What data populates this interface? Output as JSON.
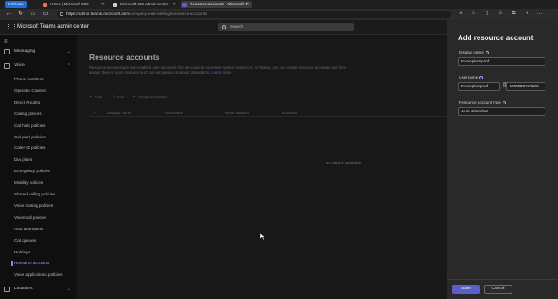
{
  "browser": {
    "inprivate_label": "InPrivate",
    "tabs": [
      {
        "label": "Home | Microsoft 365",
        "favicon_color": "#e8744b"
      },
      {
        "label": "Microsoft 365 admin center",
        "favicon_color": "#cfcfcf"
      },
      {
        "label": "Resource accounts - Microsoft T",
        "favicon_color": "#5b5fc7"
      }
    ],
    "new_tab": "+",
    "url_host": "https://admin.teams.microsoft.com",
    "url_path": "/company-wide-settings/resource-accounts"
  },
  "header": {
    "menu_icon": "waffle-icon",
    "app_title": "Microsoft Teams admin center",
    "search_placeholder": "Search"
  },
  "sidebar": {
    "top_items": [
      {
        "label": "Messaging",
        "icon": "chat-icon",
        "chevron": "⌄"
      },
      {
        "label": "Voice",
        "icon": "phone-icon",
        "chevron": "⌃"
      }
    ],
    "voice_items": [
      "Phone numbers",
      "Operator Connect",
      "Direct Routing",
      "Calling policies",
      "Call hold policies",
      "Call park policies",
      "Caller ID policies",
      "Dial plans",
      "Emergency policies",
      "Mobility policies",
      "Shared calling policies",
      "Voice routing policies",
      "Voicemail policies",
      "Auto attendants",
      "Call queues",
      "Holidays",
      "Resource accounts",
      "Voice applications policies"
    ],
    "active_item": "Resource accounts",
    "bottom_item": {
      "label": "Locations",
      "icon": "location-icon",
      "chevron": "⌄"
    }
  },
  "main": {
    "title": "Resource accounts",
    "description": "Resource accounts are non-enabled user accounts that are used to represent system resources. In Teams, you can create resource accounts and then assign them to voice features such as call queues and auto attendants.",
    "learn_more": "Learn more",
    "commands": [
      {
        "label": "Add",
        "icon": "+"
      },
      {
        "label": "Edit",
        "icon": "✎"
      },
      {
        "label": "Assign/unassign",
        "icon": "⚭"
      }
    ],
    "columns": [
      "Display name",
      "Username",
      "Phone number",
      "Licensed"
    ],
    "empty_message": "No data is available"
  },
  "panel": {
    "title": "Add resource account",
    "display_name_label": "Display name",
    "display_name_value": "Example Spoof",
    "username_label": "Username",
    "username_value": "ExampleSpoof",
    "domain_value": "M365B9250669...",
    "account_type_label": "Resource account type",
    "account_type_value": "Auto attendant",
    "save_label": "Save",
    "cancel_label": "Cancel"
  },
  "colors": {
    "accent": "#5b5fc7",
    "link": "#7f85f5"
  }
}
